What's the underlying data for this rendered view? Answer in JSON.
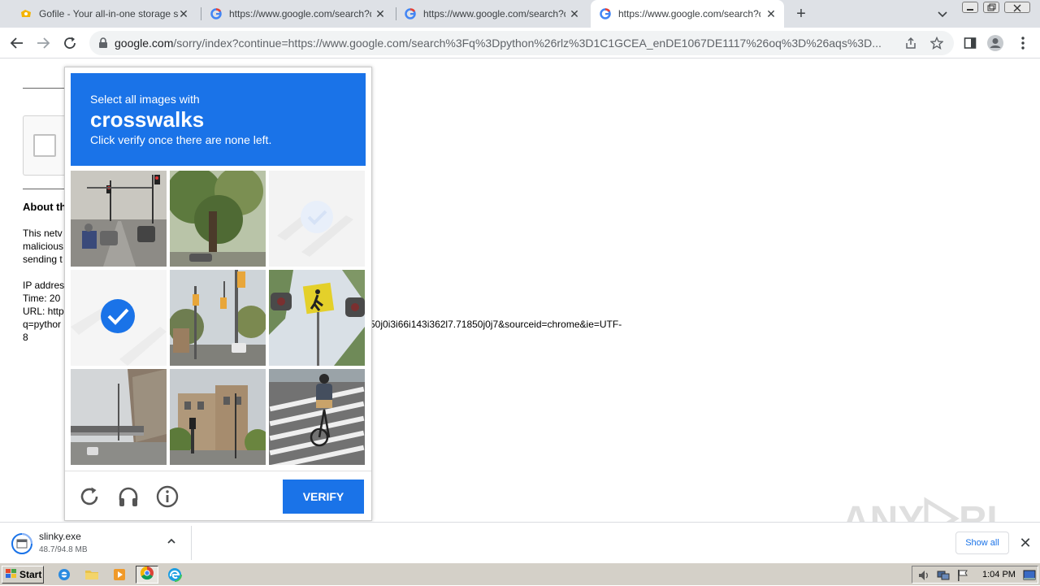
{
  "tabs": [
    {
      "title": "Gofile - Your all-in-one storage soluti",
      "favicon": "gofile-icon",
      "active": false
    },
    {
      "title": "https://www.google.com/search?q=",
      "favicon": "google-icon",
      "active": false
    },
    {
      "title": "https://www.google.com/search?q=",
      "favicon": "google-icon",
      "active": false
    },
    {
      "title": "https://www.google.com/search?q=",
      "favicon": "google-icon",
      "active": true
    }
  ],
  "new_tab_label": "+",
  "close_glyph": "✕",
  "omnibox": {
    "host": "google.com",
    "path": "/sorry/index?continue=https://www.google.com/search%3Fq%3Dpython%26rlz%3D1C1GCEA_enDE1067DE1117%26oq%3D%26aqs%3D..."
  },
  "page": {
    "about_heading": "About th",
    "para_lines": [
      "This netv",
      "malicious",
      "sending t"
    ],
    "ip_line": "IP addres",
    "time_line": "Time: 20",
    "url_line": "URL: http",
    "q_line": "q=pythor",
    "url_tail": "50j0i3i66i143i362l7.71850j0j7&sourceid=chrome&ie=UTF-",
    "url_end": "8"
  },
  "captcha": {
    "instruction_top": "Select all images with",
    "target": "crosswalks",
    "instruction_bottom": "Click verify once there are none left.",
    "verify_label": "VERIFY",
    "tiles": [
      {
        "scene": "road-traffic-lights",
        "selected": false
      },
      {
        "scene": "trees-park",
        "selected": false
      },
      {
        "scene": "crosswalk",
        "selected": true
      },
      {
        "scene": "crosswalk",
        "selected": true
      },
      {
        "scene": "street-traffic-lights",
        "selected": false
      },
      {
        "scene": "pedestrian-sign",
        "selected": false
      },
      {
        "scene": "overpass-highway",
        "selected": false
      },
      {
        "scene": "buildings-street",
        "selected": false
      },
      {
        "scene": "cyclist-crosswalk",
        "selected": false
      }
    ]
  },
  "download": {
    "name": "slinky.exe",
    "progress": "48.7/94.8 MB",
    "show_all": "Show all"
  },
  "watermark": "ANY RUN",
  "taskbar": {
    "start_label": "Start",
    "clock": "1:04 PM"
  },
  "colors": {
    "accent": "#1a73e8",
    "tabstrip": "#dee1e6",
    "taskbar": "#d4d0c8"
  }
}
